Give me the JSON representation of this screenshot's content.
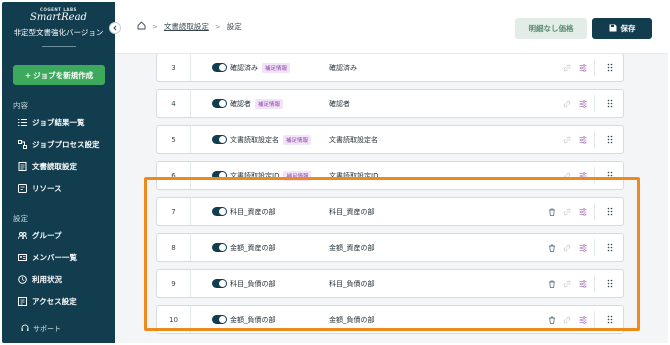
{
  "brand": {
    "company": "COGENT LABS",
    "product": "SmartRead",
    "subtitle": "非定型文書強化バージョン"
  },
  "sidebar": {
    "new_job_label": "ジョブを新規作成",
    "section_content": "内容",
    "section_settings": "設定",
    "items": [
      {
        "label": "ジョブ結果一覧",
        "icon": "list-icon"
      },
      {
        "label": "ジョブプロセス設定",
        "icon": "flow-icon"
      },
      {
        "label": "文書読取設定",
        "icon": "document-icon"
      },
      {
        "label": "リソース",
        "icon": "resource-icon"
      },
      {
        "label": "グループ",
        "icon": "group-icon"
      },
      {
        "label": "メンバー一覧",
        "icon": "member-card-icon"
      },
      {
        "label": "利用状況",
        "icon": "usage-clock-icon"
      },
      {
        "label": "アクセス設定",
        "icon": "access-icon"
      }
    ],
    "support_label": "サポート"
  },
  "header": {
    "breadcrumb_link": "文書読取設定",
    "breadcrumb_current": "設定",
    "no_price_button": "明細なし価格",
    "save_button": "保存"
  },
  "rows": [
    {
      "num": "3",
      "label": "確認済み",
      "badge": "補足情報",
      "value": "確認済み",
      "deletable": false
    },
    {
      "num": "4",
      "label": "確認者",
      "badge": "補足情報",
      "value": "確認者",
      "deletable": false
    },
    {
      "num": "5",
      "label": "文書読取設定名",
      "badge": "補足情報",
      "value": "文書読取設定名",
      "deletable": false
    },
    {
      "num": "6",
      "label": "文書読取設定ID",
      "badge": "補足情報",
      "value": "文書読取設定ID",
      "deletable": false
    },
    {
      "num": "7",
      "label": "科目_資産の部",
      "badge": "",
      "value": "科目_資産の部",
      "deletable": true
    },
    {
      "num": "8",
      "label": "金額_資産の部",
      "badge": "",
      "value": "金額_資産の部",
      "deletable": true
    },
    {
      "num": "9",
      "label": "科目_負債の部",
      "badge": "",
      "value": "科目_負債の部",
      "deletable": true
    },
    {
      "num": "10",
      "label": "金額_負債の部",
      "badge": "",
      "value": "金額_負債の部",
      "deletable": true
    }
  ],
  "colors": {
    "sidebar": "#123d4f",
    "accent_green": "#3da95c",
    "badge_purple": "#8e44ad",
    "highlight_orange": "#ee8a1c"
  }
}
